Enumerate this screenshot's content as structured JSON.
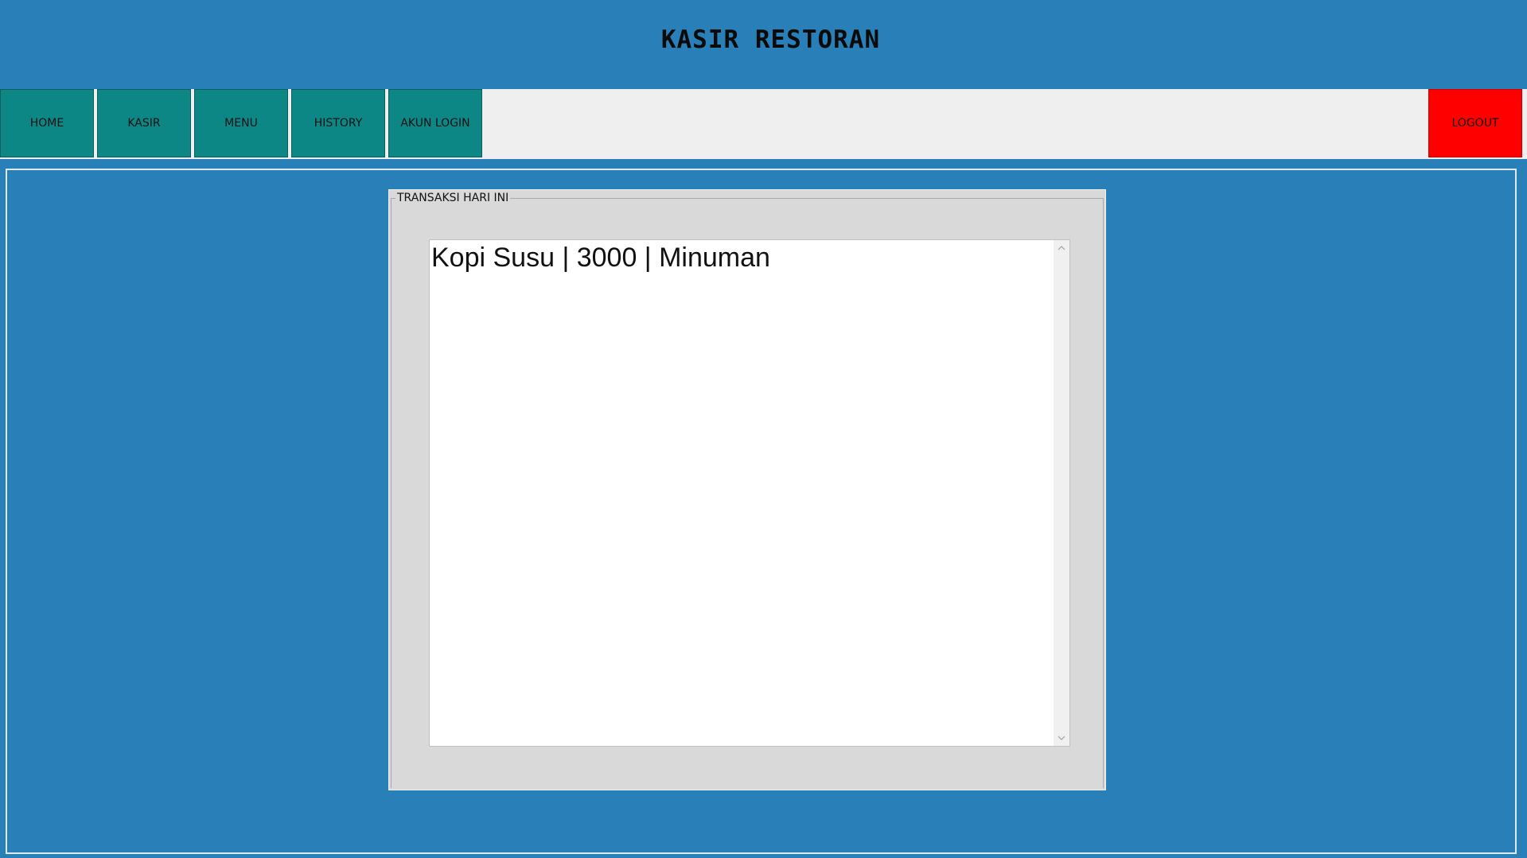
{
  "app": {
    "title": "KASIR RESTORAN"
  },
  "nav": {
    "items": [
      {
        "label": "HOME"
      },
      {
        "label": "KASIR"
      },
      {
        "label": "MENU"
      },
      {
        "label": "HISTORY"
      },
      {
        "label": "AKUN LOGIN"
      }
    ],
    "logout_label": "LOGOUT"
  },
  "panel": {
    "group_label": "TRANSAKSI HARI INI",
    "list_items": [
      {
        "text": "Kopi Susu | 3000 | Minuman"
      }
    ]
  },
  "colors": {
    "background": "#2980b9",
    "nav_button": "#0d8786",
    "logout_button": "#ff0000",
    "navbar_fill": "#efefef",
    "panel": "#d9d9d9"
  },
  "icons": {
    "scroll_up": "scroll-up-arrow-icon",
    "scroll_down": "scroll-down-arrow-icon"
  }
}
